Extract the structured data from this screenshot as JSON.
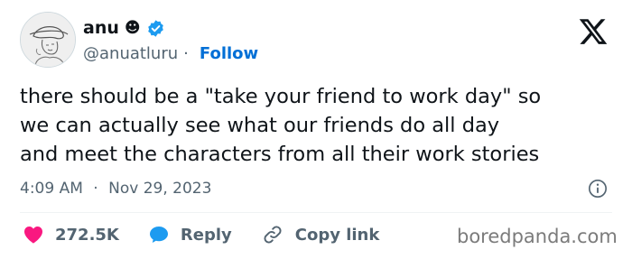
{
  "user": {
    "display_name": "anu",
    "name_emoji": "☻",
    "handle": "@anuatluru",
    "separator": "·",
    "follow_label": "Follow"
  },
  "tweet": {
    "lines": [
      "there should be a \"take your friend to work day\" so",
      "we can actually see what our friends do all day",
      "and meet the characters from all their work stories"
    ],
    "time": "4:09 AM",
    "separator": "·",
    "date": "Nov 29, 2023"
  },
  "actions": {
    "likes": "272.5K",
    "reply_label": "Reply",
    "copy_link_label": "Copy link"
  },
  "watermark": "boredpanda.com",
  "colors": {
    "heart": "#f91880",
    "reply": "#1d9bf0",
    "follow": "#006fd6",
    "verified": "#1d9bf0",
    "muted": "#536471"
  },
  "icons": [
    "avatar",
    "verified-badge-icon",
    "x-logo-icon",
    "info-icon",
    "heart-icon",
    "reply-bubble-icon",
    "link-icon"
  ]
}
